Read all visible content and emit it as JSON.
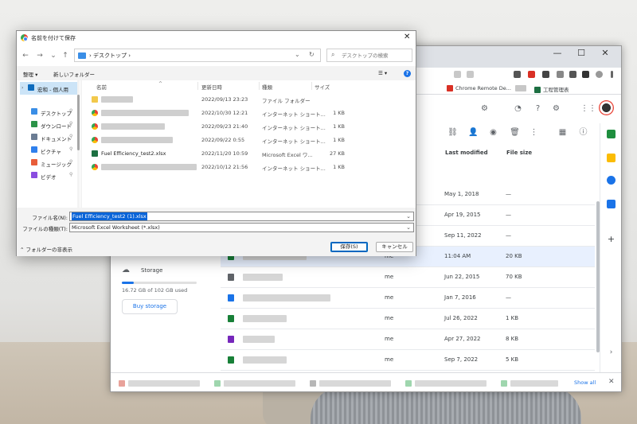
{
  "browser": {
    "window_controls": {
      "minimize": "—",
      "maximize": "☐",
      "close": "✕"
    },
    "bookmarks": [
      {
        "label": "Chrome Remote De...",
        "color": "#d93025"
      },
      {
        "label": "",
        "color": "#c7c7c7"
      },
      {
        "label": "工程管理表",
        "color": "#1d6f42"
      }
    ],
    "drive": {
      "columns": {
        "last_modified": "Last modified",
        "file_size": "File size"
      },
      "rows": [
        {
          "owner": "",
          "modified": "May 1, 2018",
          "size": "—",
          "icon_color": "",
          "selected": false
        },
        {
          "owner": "",
          "modified": "Apr 19, 2015",
          "size": "—",
          "icon_color": "",
          "selected": false
        },
        {
          "owner": "",
          "modified": "Sep 11, 2022",
          "size": "—",
          "icon_color": "",
          "selected": false
        },
        {
          "owner": "me",
          "modified": "11:04 AM",
          "size": "20 KB",
          "icon_color": "#188038",
          "selected": true
        },
        {
          "owner": "me",
          "modified": "Jun 22, 2015",
          "size": "70 KB",
          "icon_color": "#5f6368",
          "selected": false
        },
        {
          "owner": "me",
          "modified": "Jan 7, 2016",
          "size": "—",
          "icon_color": "#1a73e8",
          "selected": false
        },
        {
          "owner": "me",
          "modified": "Jul 26, 2022",
          "size": "1 KB",
          "icon_color": "#188038",
          "selected": false
        },
        {
          "owner": "me",
          "modified": "Apr 27, 2022",
          "size": "8 KB",
          "icon_color": "#7627bb",
          "selected": false
        },
        {
          "owner": "me",
          "modified": "Sep 7, 2022",
          "size": "5 KB",
          "icon_color": "#188038",
          "selected": false
        }
      ],
      "storage": {
        "label": "Storage",
        "used_text": "16.72 GB of 102 GB used",
        "used_fraction": 0.164,
        "buy_label": "Buy storage"
      },
      "downloads": {
        "show_all": "Show all",
        "close": "✕"
      }
    }
  },
  "dialog": {
    "title": "名前を付けて保存",
    "close": "✕",
    "nav": {
      "back": "←",
      "forward": "→",
      "dropdown": "⌄",
      "up": "↑"
    },
    "address": {
      "separator": "›",
      "path": "デスクトップ",
      "trail": "›",
      "dropdown": "⌄",
      "refresh": "↻"
    },
    "search": {
      "icon": "⌕",
      "placeholder": "デスクトップの検索"
    },
    "cmdbar": {
      "organize": "整理 ▾",
      "new_folder": "新しいフォルダー",
      "view": "☰ ▾",
      "help": "?"
    },
    "navpane": [
      {
        "label": "宏和 - 個人用",
        "color": "#0f6cbd",
        "pin": "",
        "top": true
      },
      {
        "label": "デスクトップ",
        "color": "#3a8ee6",
        "pin": "📌",
        "top": false
      },
      {
        "label": "ダウンロード",
        "color": "#2b9348",
        "pin": "📌",
        "top": false
      },
      {
        "label": "ドキュメント",
        "color": "#6b7c93",
        "pin": "📌",
        "top": false
      },
      {
        "label": "ピクチャ",
        "color": "#2f80ed",
        "pin": "📌",
        "top": false
      },
      {
        "label": "ミュージック",
        "color": "#e85d3a",
        "pin": "📌",
        "top": false
      },
      {
        "label": "ビデオ",
        "color": "#8a4de0",
        "pin": "📌",
        "top": false
      }
    ],
    "columns": {
      "name": "名前",
      "date": "更新日時",
      "type": "種類",
      "size": "サイズ"
    },
    "files": [
      {
        "name": "",
        "blur_w": 40,
        "date": "2022/09/13 23:23",
        "type": "ファイル フォルダー",
        "size": "",
        "icon": "folder"
      },
      {
        "name": "",
        "blur_w": 110,
        "date": "2022/10/30 12:21",
        "type": "インターネット ショート...",
        "size": "1 KB",
        "icon": "chrome"
      },
      {
        "name": "",
        "blur_w": 80,
        "date": "2022/09/23 21:40",
        "type": "インターネット ショート...",
        "size": "1 KB",
        "icon": "chrome"
      },
      {
        "name": "",
        "blur_w": 90,
        "date": "2022/09/22 0:55",
        "type": "インターネット ショート...",
        "size": "1 KB",
        "icon": "chrome"
      },
      {
        "name": "Fuel Efficiency_test2.xlsx",
        "blur_w": 0,
        "date": "2022/11/20 10:59",
        "type": "Microsoft Excel ワ...",
        "size": "27 KB",
        "icon": "excel"
      },
      {
        "name": "",
        "blur_w": 120,
        "date": "2022/10/12 21:56",
        "type": "インターネット ショート...",
        "size": "1 KB",
        "icon": "chrome"
      }
    ],
    "filename_label": "ファイル名(N):",
    "filename_value": "Fuel Efficiency_test2 (1).xlsx",
    "filetype_label": "ファイルの種類(T):",
    "filetype_value": "Microsoft Excel Worksheet (*.xlsx)",
    "dropdown": "⌄",
    "hide_folders": "⌃ フォルダーの非表示",
    "save": "保存(S)",
    "cancel": "キャンセル"
  }
}
